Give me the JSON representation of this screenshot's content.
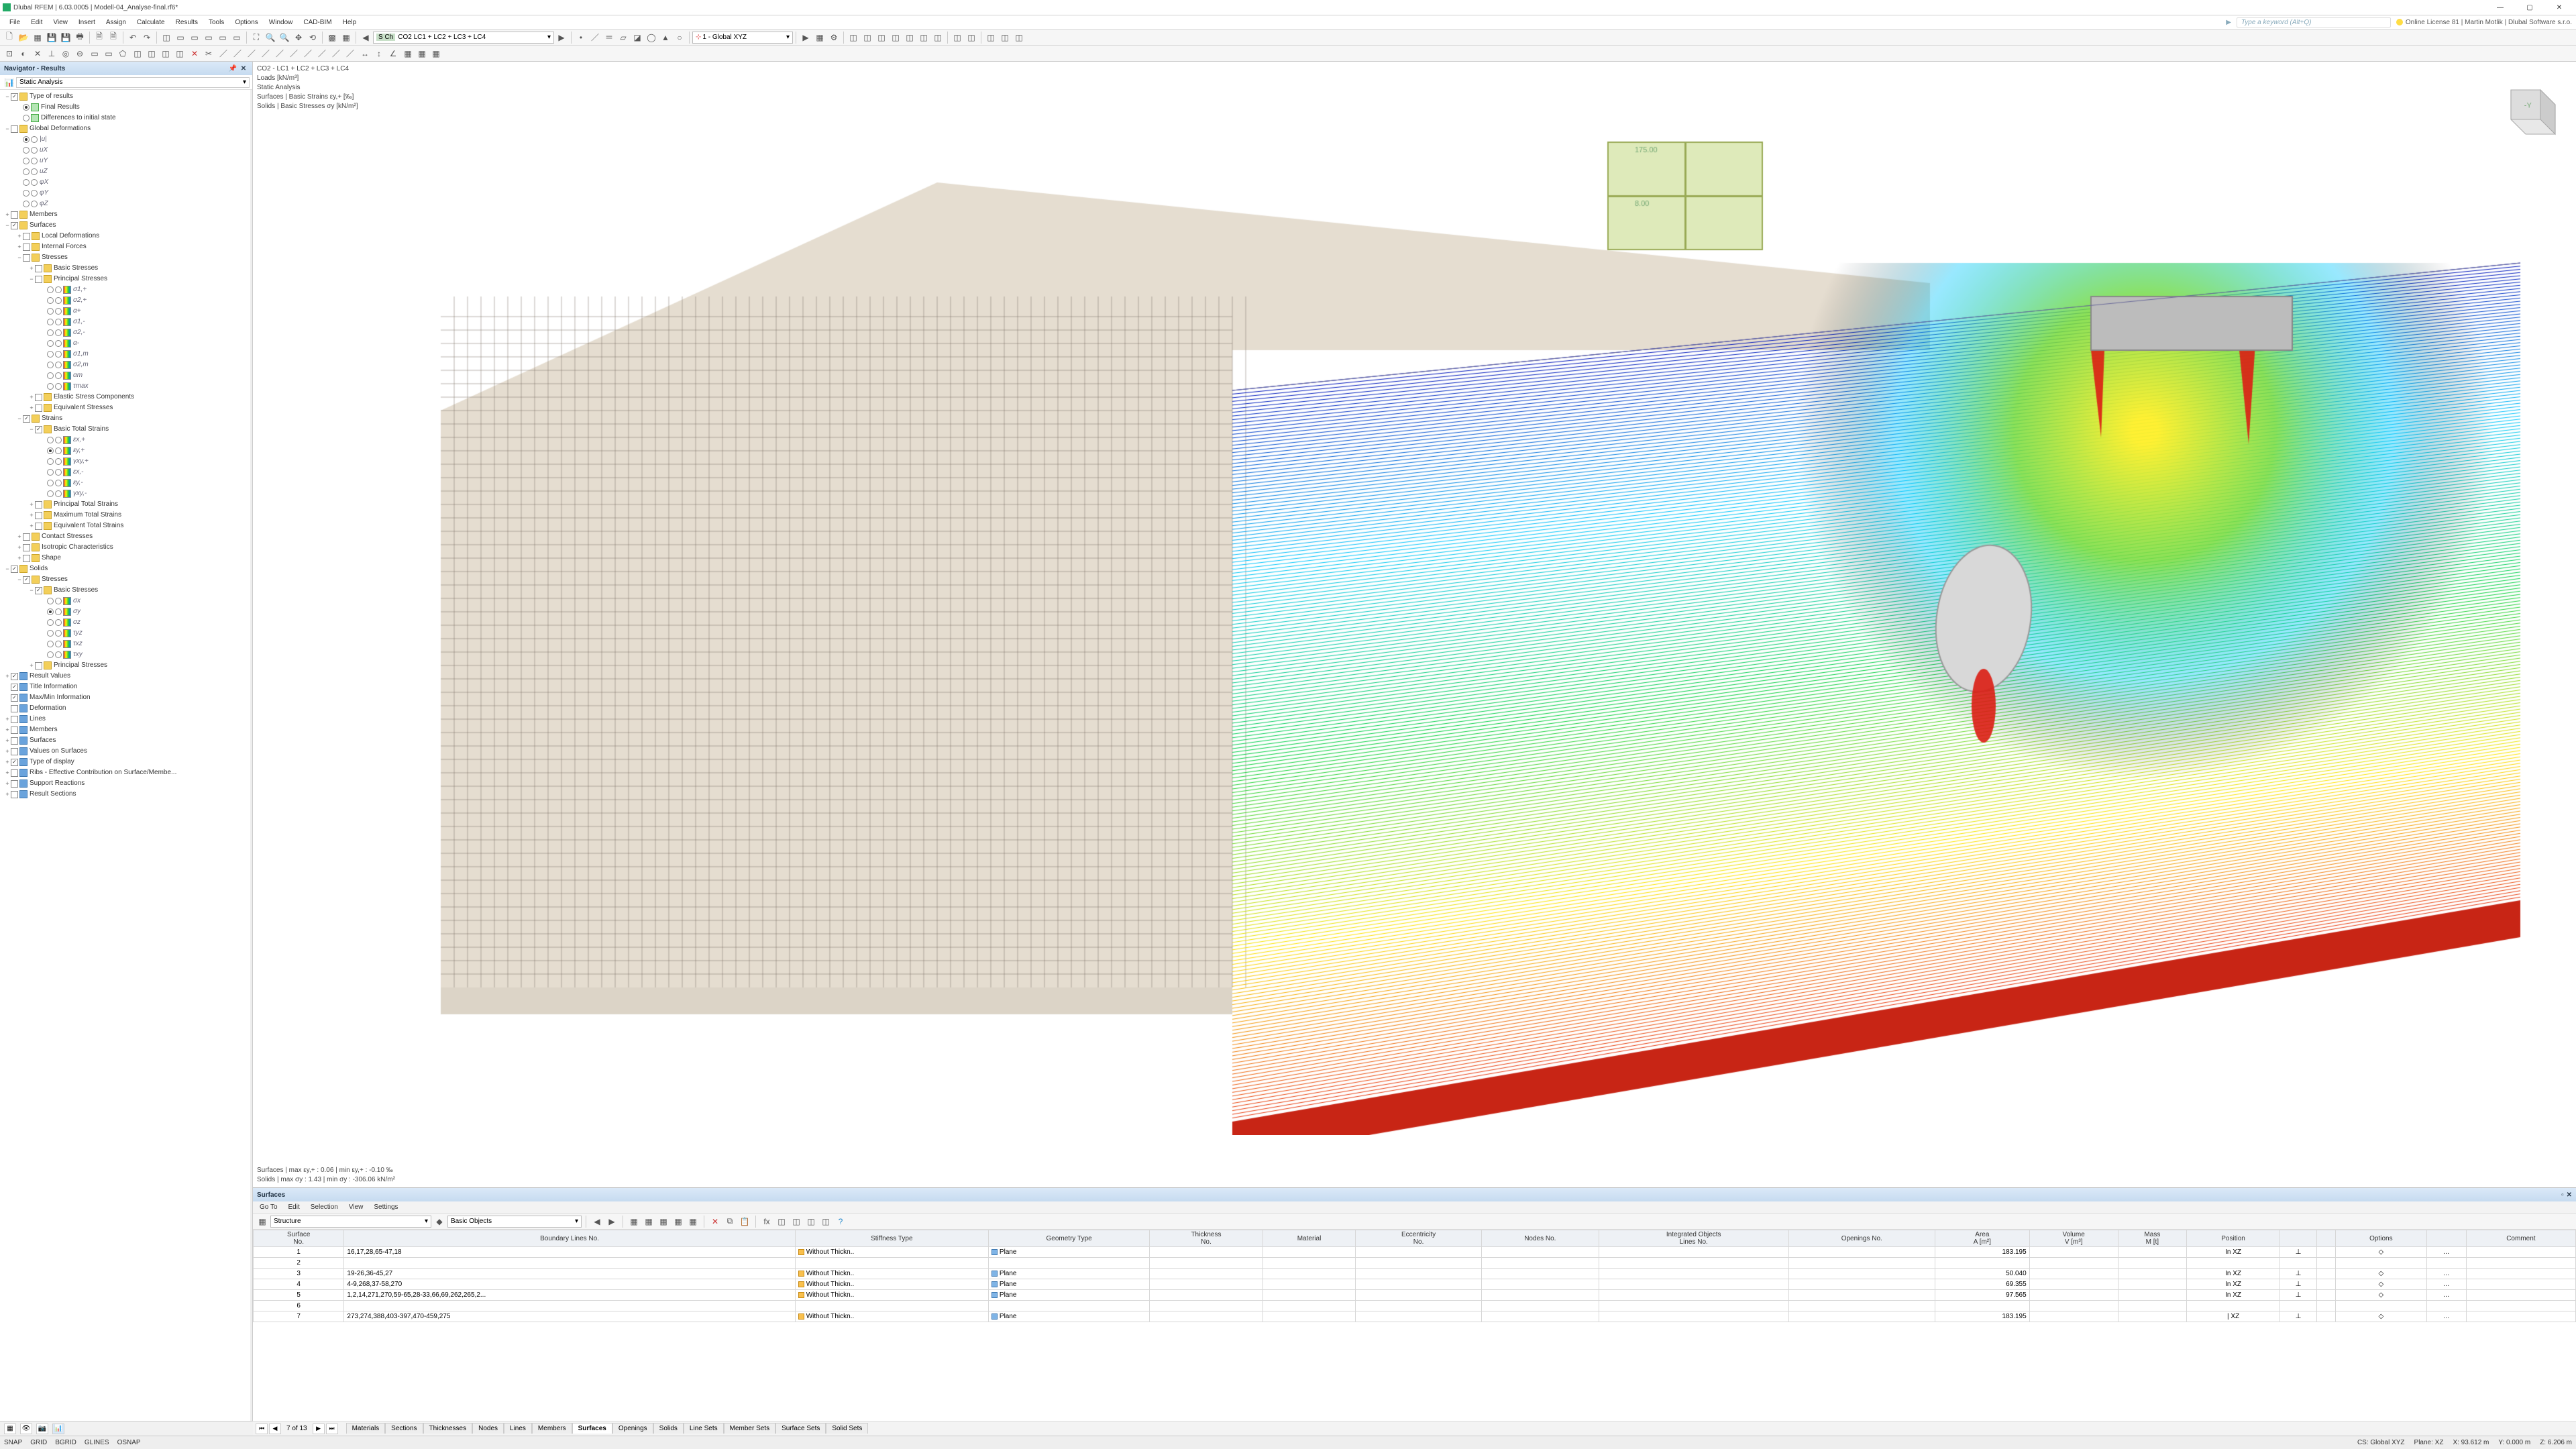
{
  "title": "Dlubal RFEM | 6.03.0005 | Modell-04_Analyse-final.rf6*",
  "menus": [
    "File",
    "Edit",
    "View",
    "Insert",
    "Assign",
    "Calculate",
    "Results",
    "Tools",
    "Options",
    "Window",
    "CAD-BIM",
    "Help"
  ],
  "search_placeholder": "Type a keyword (Alt+Q)",
  "license": "Online License 81 | Martin Motlik | Dlubal Software s.r.o.",
  "load_combo_prefix": "S Ch",
  "load_combo": "CO2   LC1 + LC2 + LC3 + LC4",
  "coord_sys": "1 - Global XYZ",
  "nav": {
    "title": "Navigator - Results",
    "analysis_dropdown": "Static Analysis",
    "tree": [
      {
        "d": 0,
        "tw": "−",
        "cb": 1,
        "ic": "folder",
        "t": "Type of results"
      },
      {
        "d": 1,
        "rb": "sel",
        "ic": "res",
        "t": "Final Results"
      },
      {
        "d": 1,
        "rb": "",
        "ic": "res",
        "t": "Differences to initial state"
      },
      {
        "d": 0,
        "tw": "−",
        "cb": 0,
        "ic": "folder",
        "t": "Global Deformations"
      },
      {
        "d": 1,
        "rb": "sel",
        "rb2": 1,
        "t": "|u|",
        "it": 1
      },
      {
        "d": 1,
        "rb": "",
        "rb2": 1,
        "t": "uX",
        "it": 1
      },
      {
        "d": 1,
        "rb": "",
        "rb2": 1,
        "t": "uY",
        "it": 1
      },
      {
        "d": 1,
        "rb": "",
        "rb2": 1,
        "t": "uZ",
        "it": 1
      },
      {
        "d": 1,
        "rb": "",
        "rb2": 1,
        "t": "φX",
        "it": 1
      },
      {
        "d": 1,
        "rb": "",
        "rb2": 1,
        "t": "φY",
        "it": 1
      },
      {
        "d": 1,
        "rb": "",
        "rb2": 1,
        "t": "φZ",
        "it": 1
      },
      {
        "d": 0,
        "tw": "+",
        "cb": 0,
        "ic": "folder",
        "t": "Members"
      },
      {
        "d": 0,
        "tw": "−",
        "cb": 1,
        "ic": "folder",
        "t": "Surfaces"
      },
      {
        "d": 1,
        "tw": "+",
        "cb": 0,
        "ic": "folder",
        "t": "Local Deformations"
      },
      {
        "d": 1,
        "tw": "+",
        "cb": 0,
        "ic": "folder",
        "t": "Internal Forces"
      },
      {
        "d": 1,
        "tw": "−",
        "cb": 0,
        "ic": "folder",
        "t": "Stresses"
      },
      {
        "d": 2,
        "tw": "+",
        "cb": 0,
        "ic": "folder",
        "t": "Basic Stresses"
      },
      {
        "d": 2,
        "tw": "−",
        "cb": 0,
        "ic": "folder",
        "t": "Principal Stresses"
      },
      {
        "d": 3,
        "rb": "",
        "rb2": 1,
        "ic": "grad",
        "t": "σ1,+",
        "it": 1
      },
      {
        "d": 3,
        "rb": "",
        "rb2": 1,
        "ic": "grad",
        "t": "σ2,+",
        "it": 1
      },
      {
        "d": 3,
        "rb": "",
        "rb2": 1,
        "ic": "grad",
        "t": "α+",
        "it": 1
      },
      {
        "d": 3,
        "rb": "",
        "rb2": 1,
        "ic": "grad",
        "t": "σ1,-",
        "it": 1
      },
      {
        "d": 3,
        "rb": "",
        "rb2": 1,
        "ic": "grad",
        "t": "σ2,-",
        "it": 1
      },
      {
        "d": 3,
        "rb": "",
        "rb2": 1,
        "ic": "grad",
        "t": "α-",
        "it": 1
      },
      {
        "d": 3,
        "rb": "",
        "rb2": 1,
        "ic": "grad",
        "t": "σ1,m",
        "it": 1
      },
      {
        "d": 3,
        "rb": "",
        "rb2": 1,
        "ic": "grad",
        "t": "σ2,m",
        "it": 1
      },
      {
        "d": 3,
        "rb": "",
        "rb2": 1,
        "ic": "grad",
        "t": "αm",
        "it": 1
      },
      {
        "d": 3,
        "rb": "",
        "rb2": 1,
        "ic": "grad",
        "t": "τmax",
        "it": 1
      },
      {
        "d": 2,
        "tw": "+",
        "cb": 0,
        "ic": "folder",
        "t": "Elastic Stress Components"
      },
      {
        "d": 2,
        "tw": "+",
        "cb": 0,
        "ic": "folder",
        "t": "Equivalent Stresses"
      },
      {
        "d": 1,
        "tw": "−",
        "cb": 1,
        "ic": "folder",
        "t": "Strains"
      },
      {
        "d": 2,
        "tw": "−",
        "cb": 1,
        "ic": "folder",
        "t": "Basic Total Strains"
      },
      {
        "d": 3,
        "rb": "",
        "rb2": 1,
        "ic": "grad",
        "t": "εx,+",
        "it": 1
      },
      {
        "d": 3,
        "rb": "sel",
        "rb2": 1,
        "ic": "grad",
        "t": "εy,+",
        "it": 1
      },
      {
        "d": 3,
        "rb": "",
        "rb2": 1,
        "ic": "grad",
        "t": "γxy,+",
        "it": 1
      },
      {
        "d": 3,
        "rb": "",
        "rb2": 1,
        "ic": "grad",
        "t": "εx,-",
        "it": 1
      },
      {
        "d": 3,
        "rb": "",
        "rb2": 1,
        "ic": "grad",
        "t": "εy,-",
        "it": 1
      },
      {
        "d": 3,
        "rb": "",
        "rb2": 1,
        "ic": "grad",
        "t": "γxy,-",
        "it": 1
      },
      {
        "d": 2,
        "tw": "+",
        "cb": 0,
        "ic": "folder",
        "t": "Principal Total Strains"
      },
      {
        "d": 2,
        "tw": "+",
        "cb": 0,
        "ic": "folder",
        "t": "Maximum Total Strains"
      },
      {
        "d": 2,
        "tw": "+",
        "cb": 0,
        "ic": "folder",
        "t": "Equivalent Total Strains"
      },
      {
        "d": 1,
        "tw": "+",
        "cb": 0,
        "ic": "folder",
        "t": "Contact Stresses"
      },
      {
        "d": 1,
        "tw": "+",
        "cb": 0,
        "ic": "folder",
        "t": "Isotropic Characteristics"
      },
      {
        "d": 1,
        "tw": "+",
        "cb": 0,
        "ic": "folder",
        "t": "Shape"
      },
      {
        "d": 0,
        "tw": "−",
        "cb": 1,
        "ic": "folder",
        "t": "Solids"
      },
      {
        "d": 1,
        "tw": "−",
        "cb": 1,
        "ic": "folder",
        "t": "Stresses"
      },
      {
        "d": 2,
        "tw": "−",
        "cb": 1,
        "ic": "folder",
        "t": "Basic Stresses"
      },
      {
        "d": 3,
        "rb": "",
        "rb2": 1,
        "ic": "grad",
        "t": "σx",
        "it": 1
      },
      {
        "d": 3,
        "rb": "sel",
        "rb2": 1,
        "ic": "grad",
        "t": "σy",
        "it": 1
      },
      {
        "d": 3,
        "rb": "",
        "rb2": 1,
        "ic": "grad",
        "t": "σz",
        "it": 1
      },
      {
        "d": 3,
        "rb": "",
        "rb2": 1,
        "ic": "grad",
        "t": "τyz",
        "it": 1
      },
      {
        "d": 3,
        "rb": "",
        "rb2": 1,
        "ic": "grad",
        "t": "τxz",
        "it": 1
      },
      {
        "d": 3,
        "rb": "",
        "rb2": 1,
        "ic": "grad",
        "t": "τxy",
        "it": 1
      },
      {
        "d": 2,
        "tw": "+",
        "cb": 0,
        "ic": "folder",
        "t": "Principal Stresses"
      },
      {
        "d": 0,
        "tw": "+",
        "cb": 1,
        "ic": "blue",
        "t": "Result Values"
      },
      {
        "d": 0,
        "cb": 1,
        "ic": "blue",
        "t": "Title Information"
      },
      {
        "d": 0,
        "cb": 1,
        "ic": "blue",
        "t": "Max/Min Information"
      },
      {
        "d": 0,
        "cb": 0,
        "ic": "blue",
        "t": "Deformation"
      },
      {
        "d": 0,
        "tw": "+",
        "cb": 0,
        "ic": "blue",
        "t": "Lines"
      },
      {
        "d": 0,
        "tw": "+",
        "cb": 0,
        "ic": "blue",
        "t": "Members"
      },
      {
        "d": 0,
        "tw": "+",
        "cb": 0,
        "ic": "blue",
        "t": "Surfaces"
      },
      {
        "d": 0,
        "tw": "+",
        "cb": 0,
        "ic": "blue",
        "t": "Values on Surfaces"
      },
      {
        "d": 0,
        "tw": "+",
        "cb": 1,
        "ic": "blue",
        "t": "Type of display"
      },
      {
        "d": 0,
        "tw": "+",
        "cb": 0,
        "ic": "blue",
        "t": "Ribs - Effective Contribution on Surface/Membe..."
      },
      {
        "d": 0,
        "tw": "+",
        "cb": 0,
        "ic": "blue",
        "t": "Support Reactions"
      },
      {
        "d": 0,
        "tw": "+",
        "cb": 0,
        "ic": "blue",
        "t": "Result Sections"
      }
    ]
  },
  "overlay": {
    "l1": "CO2 - LC1 + LC2 + LC3 + LC4",
    "l2": "Loads [kN/m³]",
    "l3": "Static Analysis",
    "l4": "Surfaces | Basic Strains εy,+  [‰]",
    "l5": "Solids | Basic Stresses σy  [kN/m²]",
    "b1": "Surfaces | max εy,+ : 0.06 | min εy,+ : -0.10 ‰",
    "b2": "Solids | max σy : 1.43 | min σy : -306.06 kN/m²"
  },
  "panel": {
    "title": "Surfaces",
    "menus": [
      "Go To",
      "Edit",
      "Selection",
      "View",
      "Settings"
    ],
    "dropdown1": "Structure",
    "dropdown2": "Basic Objects",
    "cols": [
      "Surface\nNo.",
      "Boundary Lines No.",
      "Stiffness Type",
      "Geometry Type",
      "Thickness\nNo.",
      "Material",
      "Eccentricity\nNo.",
      "Nodes No.",
      "Integrated Objects\nLines No.",
      "Openings No.",
      "Area\nA [m²]",
      "Volume\nV [m³]",
      "Mass\nM [t]",
      "Position",
      "",
      "",
      " Options",
      " ",
      "Comment"
    ],
    "rows": [
      {
        "no": "1",
        "bl": "16,17,28,65-47,18",
        "st": "Without Thickn..",
        "gt": "Plane",
        "area": "183.195",
        "pos": "In XZ"
      },
      {
        "no": "2",
        "bl": "",
        "st": "",
        "gt": "",
        "area": "",
        "pos": ""
      },
      {
        "no": "3",
        "bl": "19-26,36-45,27",
        "st": "Without Thickn..",
        "gt": "Plane",
        "area": "50.040",
        "pos": "In XZ"
      },
      {
        "no": "4",
        "bl": "4-9,268,37-58,270",
        "st": "Without Thickn..",
        "gt": "Plane",
        "area": "69.355",
        "pos": "In XZ"
      },
      {
        "no": "5",
        "bl": "1,2,14,271,270,59-65,28-33,66,69,262,265,2...",
        "st": "Without Thickn..",
        "gt": "Plane",
        "area": "97.565",
        "pos": "In XZ"
      },
      {
        "no": "6",
        "bl": "",
        "st": "",
        "gt": "",
        "area": "",
        "pos": ""
      },
      {
        "no": "7",
        "bl": "273,274,388,403-397,470-459,275",
        "st": "Without Thickn..",
        "gt": "Plane",
        "area": "183.195",
        "pos": "| XZ"
      }
    ],
    "pager": "7 of 13",
    "tabs": [
      "Materials",
      "Sections",
      "Thicknesses",
      "Nodes",
      "Lines",
      "Members",
      "Surfaces",
      "Openings",
      "Solids",
      "Line Sets",
      "Member Sets",
      "Surface Sets",
      "Solid Sets"
    ],
    "active_tab": "Surfaces"
  },
  "status": {
    "snaps": [
      "SNAP",
      "GRID",
      "BGRID",
      "GLINES",
      "OSNAP"
    ],
    "cs": "CS: Global XYZ",
    "plane": "Plane: XZ",
    "x": "X: 93.612 m",
    "y": "Y: 0.000 m",
    "z": "Z: 6.206 m"
  }
}
